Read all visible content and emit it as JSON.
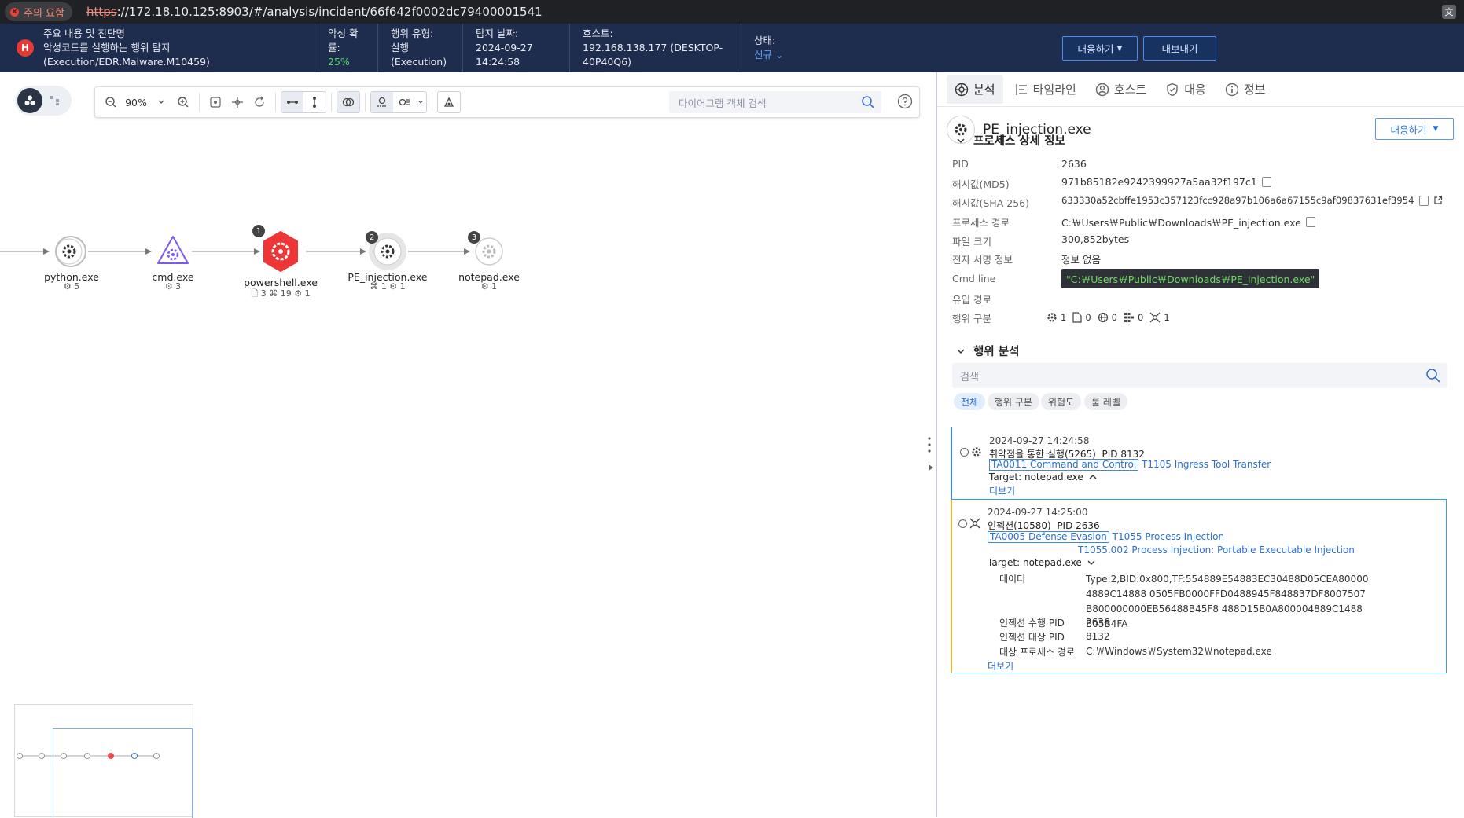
{
  "browser": {
    "security_label": "주의 요함",
    "url_scheme": "https",
    "url_rest": "://172.18.10.125:8903/#/analysis/incident/66f642f0002dc79400001541",
    "translate_icon": "translate-icon"
  },
  "header": {
    "severity": "H",
    "title_label": "주요 내용 및 진단명",
    "title_value": "악성코드를 실행하는 행위 탐지 (Execution/EDR.Malware.M10459)",
    "prob_label": "악성 확률:",
    "prob_value": "25%",
    "type_label": "행위 유형:",
    "type_value": "실행(Execution)",
    "date_label": "탐지 날짜:",
    "date_value": "2024-09-27 14:24:58",
    "host_label": "호스트:",
    "host_value": "192.168.138.177 (DESKTOP-40P40Q6)",
    "status_label": "상태:",
    "status_value": "신규",
    "respond_btn": "대응하기",
    "export_btn": "내보내기"
  },
  "toolbar": {
    "zoom": "90%",
    "search_placeholder": "다이어그램 객체 검색"
  },
  "graph": {
    "nodes": [
      {
        "label": "python.exe",
        "sub": "⚙ 5"
      },
      {
        "label": "cmd.exe",
        "sub": "⚙ 3"
      },
      {
        "label": "powershell.exe",
        "sub": "🗋 3 ⌘ 19 ⚙ 1",
        "badge": "1"
      },
      {
        "label": "PE_injection.exe",
        "sub": "⌘ 1 ⚙ 1",
        "badge": "2"
      },
      {
        "label": "notepad.exe",
        "sub": "⚙ 1",
        "badge": "3"
      }
    ]
  },
  "tabs": [
    {
      "label": "분석",
      "icon": "analysis-icon"
    },
    {
      "label": "타임라인",
      "icon": "timeline-icon"
    },
    {
      "label": "호스트",
      "icon": "host-icon"
    },
    {
      "label": "대응",
      "icon": "shield-icon"
    },
    {
      "label": "정보",
      "icon": "info-icon"
    }
  ],
  "process": {
    "name": "PE_injection.exe",
    "respond_btn": "대응하기",
    "detail_title": "프로세스 상세 정보",
    "fields": {
      "pid_label": "PID",
      "pid": "2636",
      "md5_label": "해시값(MD5)",
      "md5": "971b85182e9242399927a5aa32f197c1",
      "sha_label": "해시값(SHA 256)",
      "sha": "633330a52cbffe1953c357123fcc928a97b106a6a67155c9af09837631ef3954",
      "path_label": "프로세스 경로",
      "path": "C:￦Users￦Public￦Downloads￦PE_injection.exe",
      "size_label": "파일 크기",
      "size": "300,852bytes",
      "sign_label": "전자 서명 정보",
      "sign": "정보 없음",
      "cmd_label": "Cmd line",
      "cmd": "\"C:￦Users￦Public￦Downloads￦PE_injection.exe\"",
      "inflow_label": "유입 경로",
      "behavior_label": "행위 구분",
      "behavior_counts": [
        "1",
        "0",
        "0",
        "0",
        "1"
      ]
    }
  },
  "behavior": {
    "title": "행위 분석",
    "search_placeholder": "검색",
    "chips": [
      "전체",
      "행위 구분",
      "위험도",
      "룰 레벨"
    ],
    "cards": [
      {
        "time": "2024-09-27 14:24:58",
        "title": "취약점을 통한 실행(5265)",
        "pid": "PID 8132",
        "tactic": "TA0011 Command and Control",
        "technique": "T1105 Ingress Tool Transfer",
        "target": "Target: notepad.exe",
        "more": "더보기"
      },
      {
        "time": "2024-09-27 14:25:00",
        "title": "인젝션(10580)",
        "pid": "PID 2636",
        "tactic": "TA0005 Defense Evasion",
        "technique": "T1055 Process Injection",
        "technique2": "T1055.002 Process Injection: Portable Executable Injection",
        "target": "Target: notepad.exe",
        "data_label": "데이터",
        "data_value": "Type:2,BID:0x800,TF:554889E54883EC30488D05CEA800004889C14888 0505FB0000FFD0488945F848837DF8007507B800000000EB56488B45F8 488D15B0A800004889C1488B05B4FA",
        "inj_pid_label": "인젝션 수행 PID",
        "inj_pid": "2636",
        "tgt_pid_label": "인젝션 대상 PID",
        "tgt_pid": "8132",
        "tgt_path_label": "대상 프로세스 경로",
        "tgt_path": "C:￦Windows￦System32￦notepad.exe",
        "more": "더보기"
      }
    ]
  }
}
